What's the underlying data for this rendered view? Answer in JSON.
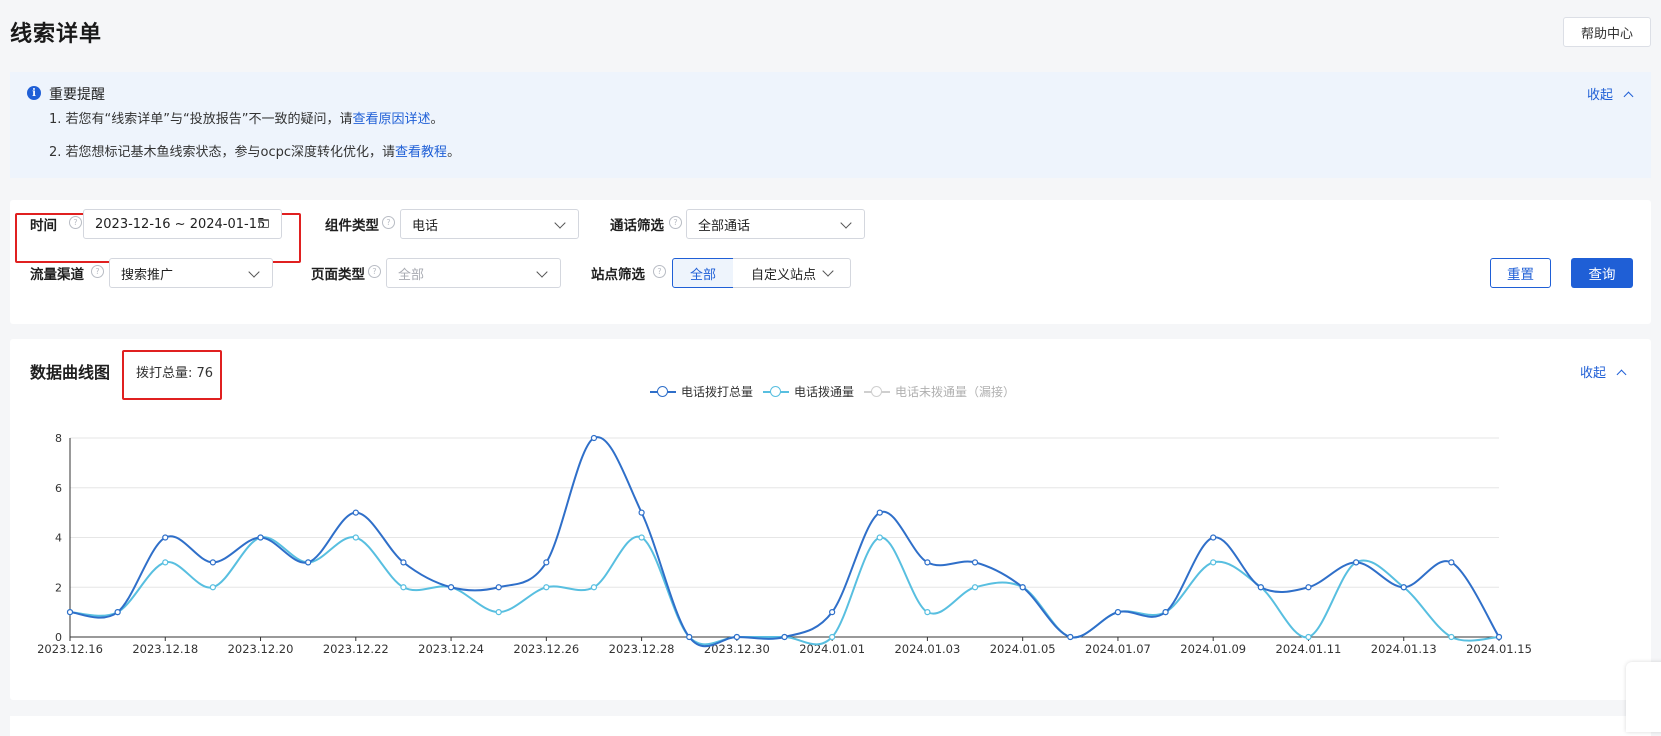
{
  "page": {
    "title": "线索详单",
    "help_label": "帮助中心"
  },
  "notice": {
    "title": "重要提醒",
    "collapse_label": "收起",
    "line1_prefix": "1. 若您有“线索详单”与“投放报告”不一致的疑问，请",
    "line1_link": "查看原因详述",
    "line1_suffix": "。",
    "line2_prefix": "2. 若您想标记基木鱼线索状态，参与ocpc深度转化优化，请",
    "line2_link": "查看教程",
    "line2_suffix": "。"
  },
  "filters": {
    "time": {
      "label": "时间",
      "value": "2023-12-16 ~ 2024-01-15"
    },
    "component_type": {
      "label": "组件类型",
      "value": "电话"
    },
    "call_filter": {
      "label": "通话筛选",
      "value": "全部通话"
    },
    "traffic_channel": {
      "label": "流量渠道",
      "value": "搜索推广"
    },
    "page_type": {
      "label": "页面类型",
      "value": "全部"
    },
    "site_filter": {
      "label": "站点筛选",
      "option_all": "全部",
      "option_custom": "自定义站点"
    },
    "reset_label": "重置",
    "query_label": "查询"
  },
  "chart_section": {
    "title": "数据曲线图",
    "total_label": "拨打总量: 76",
    "collapse_label": "收起"
  },
  "colors": {
    "primary": "#1f5fd6",
    "series_total": "#2f6fc9",
    "series_connected": "#58bfe0",
    "series_missed": "#cfcfcf",
    "highlight_box": "#e02020"
  },
  "chart_data": {
    "type": "line",
    "x": [
      "2023.12.16",
      "2023.12.17",
      "2023.12.18",
      "2023.12.19",
      "2023.12.20",
      "2023.12.21",
      "2023.12.22",
      "2023.12.23",
      "2023.12.24",
      "2023.12.25",
      "2023.12.26",
      "2023.12.27",
      "2023.12.28",
      "2023.12.29",
      "2023.12.30",
      "2023.12.31",
      "2024.01.01",
      "2024.01.02",
      "2024.01.03",
      "2024.01.04",
      "2024.01.05",
      "2024.01.06",
      "2024.01.07",
      "2024.01.08",
      "2024.01.09",
      "2024.01.10",
      "2024.01.11",
      "2024.01.12",
      "2024.01.13",
      "2024.01.14",
      "2024.01.15"
    ],
    "x_tick_labels": [
      "2023.12.16",
      "2023.12.18",
      "2023.12.20",
      "2023.12.22",
      "2023.12.24",
      "2023.12.26",
      "2023.12.28",
      "2023.12.30",
      "2024.01.01",
      "2024.01.03",
      "2024.01.05",
      "2024.01.07",
      "2024.01.09",
      "2024.01.11",
      "2024.01.13",
      "2024.01.15"
    ],
    "y_ticks": [
      "0",
      "2",
      "4",
      "6",
      "8"
    ],
    "ylim": [
      0,
      8
    ],
    "grid": true,
    "legend_position": "top-center",
    "series": [
      {
        "name": "电话拨打总量",
        "enabled": true,
        "values": [
          1,
          1,
          4,
          3,
          4,
          3,
          5,
          3,
          2,
          2,
          3,
          8,
          5,
          0,
          0,
          0,
          1,
          5,
          3,
          3,
          2,
          0,
          1,
          1,
          4,
          2,
          2,
          3,
          2,
          3,
          0
        ]
      },
      {
        "name": "电话拨通量",
        "enabled": true,
        "values": [
          1,
          1,
          3,
          2,
          4,
          3,
          4,
          2,
          2,
          1,
          2,
          2,
          4,
          0,
          0,
          0,
          0,
          4,
          1,
          2,
          2,
          0,
          1,
          1,
          3,
          2,
          0,
          3,
          2,
          0,
          0
        ]
      },
      {
        "name": "电话未拨通量（漏接）",
        "enabled": false,
        "values": []
      }
    ]
  }
}
